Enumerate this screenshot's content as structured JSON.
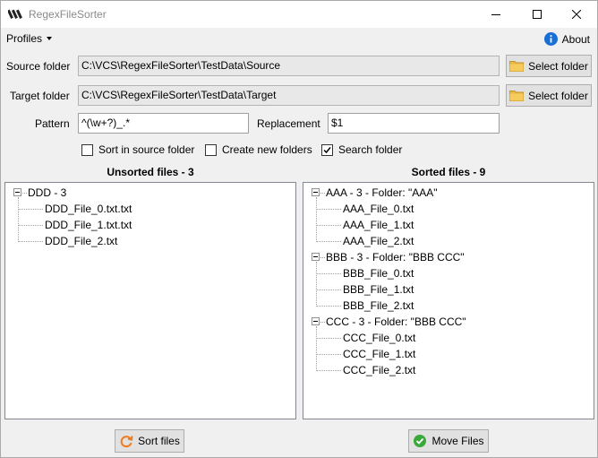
{
  "window": {
    "title": "RegexFileSorter"
  },
  "menu": {
    "profiles": "Profiles",
    "about": "About"
  },
  "form": {
    "source_label": "Source folder",
    "source_value": "C:\\VCS\\RegexFileSorter\\TestData\\Source",
    "target_label": "Target folder",
    "target_value": "C:\\VCS\\RegexFileSorter\\TestData\\Target",
    "select_folder": "Select folder",
    "pattern_label": "Pattern",
    "pattern_value": "^(\\w+?)_.*",
    "replacement_label": "Replacement",
    "replacement_value": "$1",
    "options": [
      {
        "label": "Sort in source folder",
        "checked": false
      },
      {
        "label": "Create new folders",
        "checked": false
      },
      {
        "label": "Search folder",
        "checked": true
      }
    ]
  },
  "unsorted": {
    "title": "Unsorted files - 3",
    "groups": [
      {
        "label": "DDD - 3",
        "files": [
          "DDD_File_0.txt.txt",
          "DDD_File_1.txt.txt",
          "DDD_File_2.txt"
        ]
      }
    ]
  },
  "sorted": {
    "title": "Sorted files - 9",
    "groups": [
      {
        "label": "AAA - 3 - Folder: \"AAA\"",
        "files": [
          "AAA_File_0.txt",
          "AAA_File_1.txt",
          "AAA_File_2.txt"
        ]
      },
      {
        "label": "BBB - 3 - Folder: \"BBB CCC\"",
        "files": [
          "BBB_File_0.txt",
          "BBB_File_1.txt",
          "BBB_File_2.txt"
        ]
      },
      {
        "label": "CCC - 3 - Folder: \"BBB CCC\"",
        "files": [
          "CCC_File_0.txt",
          "CCC_File_1.txt",
          "CCC_File_2.txt"
        ]
      }
    ]
  },
  "actions": {
    "sort_files": "Sort files",
    "move_files": "Move Files"
  },
  "colors": {
    "folder": "#e8b84a",
    "info": "#1a6fd6",
    "sort_icon": "#f07a1a",
    "move_icon": "#3aa83a"
  }
}
